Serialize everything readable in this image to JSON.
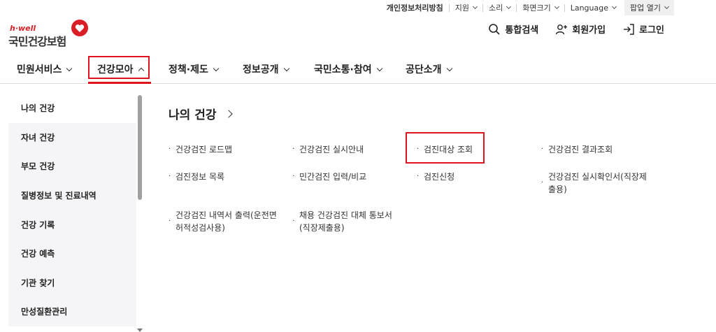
{
  "utility": {
    "privacy": "개인정보처리방침",
    "support": "지원",
    "sound": "소리",
    "screen_size": "화면크기",
    "language": "Language",
    "popup": "팝업 열기"
  },
  "logo": {
    "tagline": "h·well",
    "name": "국민건강보험"
  },
  "header": {
    "search": "통합검색",
    "join": "회원가입",
    "login": "로그인"
  },
  "gnb": [
    {
      "label": "민원서비스"
    },
    {
      "label": "건강모아"
    },
    {
      "label": "정책·제도"
    },
    {
      "label": "정보공개"
    },
    {
      "label": "국민소통·참여"
    },
    {
      "label": "공단소개"
    }
  ],
  "sidebar": [
    {
      "label": "나의 건강"
    },
    {
      "label": "자녀 건강"
    },
    {
      "label": "부모 건강"
    },
    {
      "label": "질병정보 및 진료내역"
    },
    {
      "label": "건강 기록"
    },
    {
      "label": "건강 예측"
    },
    {
      "label": "기관 찾기"
    },
    {
      "label": "만성질환관리"
    }
  ],
  "content": {
    "title": "나의 건강",
    "links": [
      {
        "label": "건강검진 로드맵"
      },
      {
        "label": "건강검진 실시안내"
      },
      {
        "label": "검진대상 조회"
      },
      {
        "label": "건강검진 결과조회"
      },
      {
        "label": "검진정보 목록"
      },
      {
        "label": "민간검진 입력/비교"
      },
      {
        "label": "검진신청"
      },
      {
        "label": "건강검진 실시확인서(직장제\n출용)"
      },
      {
        "label": "건강검진 내역서 출력(운전면\n허적성검사용)"
      },
      {
        "label": "채용 건강검진 대체 통보서\n(직장제출용)"
      }
    ]
  },
  "colors": {
    "accent": "#e0141e",
    "brand_red": "#d81f26"
  }
}
